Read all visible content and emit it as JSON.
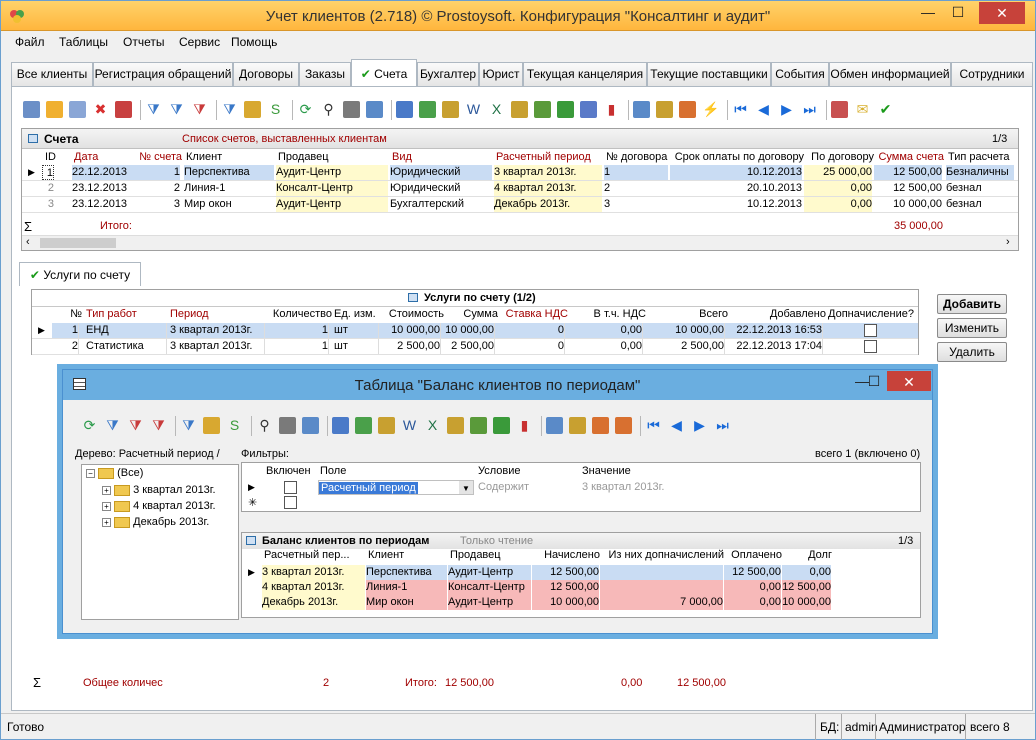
{
  "window": {
    "title": "Учет клиентов (2.718) © Prostoysoft. Конфигурация \"Консалтинг и аудит\"",
    "btn_min": "—",
    "btn_max": "☐",
    "btn_close": "✕"
  },
  "menu": [
    "Файл",
    "Таблицы",
    "Отчеты",
    "Сервис",
    "Помощь"
  ],
  "tabs": [
    "Все клиенты",
    "Регистрация обращений",
    "Договоры",
    "Заказы",
    "Счета",
    "Бухгалтер",
    "Юрист",
    "Текущая канцелярия",
    "Текущие поставщики",
    "События",
    "Обмен информацией",
    "Сотрудники"
  ],
  "active_tab_check": "✔",
  "invoices": {
    "title": "Счета",
    "subtitle": "Список счетов, выставленных клиентам",
    "counter": "1/3",
    "columns": [
      "ID",
      "Дата",
      "№ счета",
      "Клиент",
      "Продавец",
      "Вид",
      "Расчетный период",
      "№ договора",
      "Срок оплаты по договору",
      "По договору",
      "Сумма счета",
      "Тип расчета"
    ],
    "rows": [
      [
        "1",
        "22.12.2013",
        "1",
        "Перспектива",
        "Аудит-Центр",
        "Юридический",
        "3 квартал 2013г.",
        "1",
        "10.12.2013",
        "25 000,00",
        "12 500,00",
        "Безналичны"
      ],
      [
        "2",
        "23.12.2013",
        "2",
        "Линия-1",
        "Консалт-Центр",
        "Юридический",
        "4 квартал 2013г.",
        "2",
        "20.10.2013",
        "0,00",
        "12 500,00",
        "безнал"
      ],
      [
        "3",
        "23.12.2013",
        "3",
        "Мир окон",
        "Аудит-Центр",
        "Бухгалтерский",
        "Декабрь 2013г.",
        "3",
        "10.12.2013",
        "0,00",
        "10 000,00",
        "безнал"
      ]
    ],
    "sum_symbol": "Σ",
    "total_label": "Итого:",
    "total_value": "35 000,00"
  },
  "services_tab": {
    "check": "✔",
    "label": "Услуги по счету"
  },
  "services": {
    "title": "Услуги по счету (1/2)",
    "columns": [
      "№",
      "Тип работ",
      "Период",
      "Количество",
      "Ед. изм.",
      "Стоимость",
      "Сумма",
      "Ставка НДС",
      "В т.ч. НДС",
      "Всего",
      "Добавлено",
      "Допначисление?"
    ],
    "rows": [
      [
        "1",
        "ЕНД",
        "3 квартал 2013г.",
        "1",
        "шт",
        "10 000,00",
        "10 000,00",
        "0",
        "0,00",
        "10 000,00",
        "22.12.2013 16:53"
      ],
      [
        "2",
        "Статистика",
        "3 квартал 2013г.",
        "1",
        "шт",
        "2 500,00",
        "2 500,00",
        "0",
        "0,00",
        "2 500,00",
        "22.12.2013 17:04"
      ]
    ],
    "total_count_label": "Общее количес",
    "total_count": "2",
    "total_label": "Итого:",
    "total_sum": "12 500,00",
    "total_vat": "0,00",
    "total_all": "12 500,00"
  },
  "buttons": {
    "add": "Добавить",
    "edit": "Изменить",
    "delete": "Удалить"
  },
  "modal": {
    "title": "Таблица \"Баланс клиентов по периодам\"",
    "btn_min": "—",
    "btn_max": "☐",
    "btn_close": "✕",
    "tree_title": "Дерево: Расчетный период /",
    "tree_root": "(Все)",
    "tree_items": [
      "3 квартал 2013г.",
      "4 квартал 2013г.",
      "Декабрь 2013г."
    ],
    "filters_title": "Фильтры:",
    "filters_count": "всего 1 (включено 0)",
    "filter_columns": [
      "Включен",
      "Поле",
      "Условие",
      "Значение"
    ],
    "filter_row": {
      "field": "Расчетный период",
      "condition": "Содержит",
      "value": "3 квартал 2013г."
    },
    "balance_title": "Баланс клиентов по периодам",
    "balance_sub": "Только чтение",
    "balance_counter": "1/3",
    "balance_columns": [
      "Расчетный пер...",
      "Клиент",
      "Продавец",
      "Начислено",
      "Из них допначислений",
      "Оплачено",
      "Долг"
    ],
    "balance_rows": [
      [
        "3 квартал 2013г.",
        "Перспектива",
        "Аудит-Центр",
        "12 500,00",
        "",
        "12 500,00",
        "0,00"
      ],
      [
        "4 квартал 2013г.",
        "Линия-1",
        "Консалт-Центр",
        "12 500,00",
        "",
        "0,00",
        "12 500,00"
      ],
      [
        "Декабрь 2013г.",
        "Мир окон",
        "Аудит-Центр",
        "10 000,00",
        "7 000,00",
        "0,00",
        "10 000,00"
      ]
    ]
  },
  "status": {
    "ready": "Готово",
    "db_label": "БД:",
    "user": "admin",
    "role": "Администратор",
    "total": "всего 8"
  }
}
